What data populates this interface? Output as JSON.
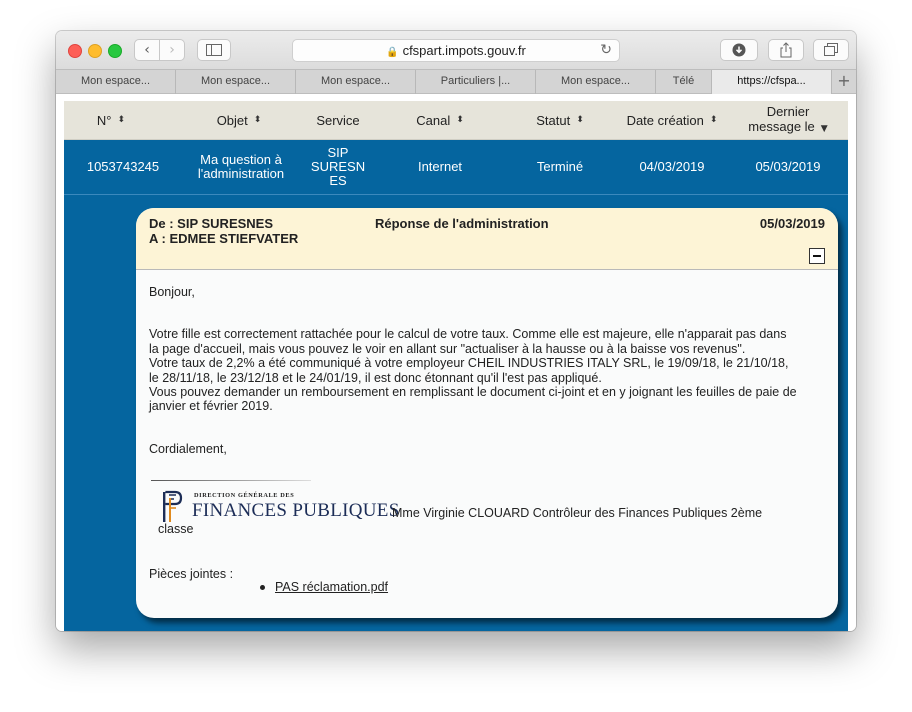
{
  "browser": {
    "url": "cfspart.impots.gouv.fr",
    "tabs": [
      {
        "label": "Mon espace..."
      },
      {
        "label": "Mon espace..."
      },
      {
        "label": "Mon espace..."
      },
      {
        "label": "Particuliers |..."
      },
      {
        "label": "Mon espace..."
      },
      {
        "label": "Télé"
      },
      {
        "label": "https://cfspa..."
      }
    ],
    "icons": {
      "back": "chevron-left-icon",
      "forward": "chevron-right-icon",
      "sidebar": "sidebar-icon",
      "lock": "lock-icon",
      "reload": "reload-icon",
      "download": "download-icon",
      "share": "share-icon",
      "tabs": "tabs-overview-icon",
      "new_tab": "plus-icon"
    }
  },
  "table": {
    "headers": {
      "num": "N°",
      "objet": "Objet",
      "service": "Service",
      "canal": "Canal",
      "statut": "Statut",
      "date_creation": "Date création",
      "dernier_message_1": "Dernier",
      "dernier_message_2": "message le"
    },
    "row": {
      "num": "1053743245",
      "objet_1": "Ma question à",
      "objet_2": "l'administration",
      "service_1": "SIP",
      "service_2": "SURESN",
      "service_3": "ES",
      "canal": "Internet",
      "statut": "Terminé",
      "date_creation": "04/03/2019",
      "dernier_message": "05/03/2019"
    }
  },
  "message": {
    "from": "De : SIP SURESNES",
    "to": "A : EDMEE STIEFVATER",
    "subject": "Réponse de l'administration",
    "date": "05/03/2019",
    "greeting": "Bonjour,",
    "lines": [
      "Votre fille est correctement rattachée pour le calcul de votre taux. Comme elle est majeure, elle n'apparait pas dans",
      "la page d'accueil, mais vous pouvez le voir en allant sur \"actualiser à la hausse ou à la baisse vos revenus\".",
      "Votre taux de 2,2% a été communiqué à votre employeur CHEIL INDUSTRIES ITALY SRL, le 19/09/18, le 21/10/18,",
      "le 28/11/18, le 23/12/18 et le 24/01/19, il est donc étonnant qu'il l'est pas appliqué.",
      "Vous pouvez demander un remboursement en remplissant le document ci-joint et en y joignant les feuilles de paie de",
      "janvier et février 2019."
    ],
    "closing": "Cordialement,",
    "logo_small": "DIRECTION GÉNÉRALE DES",
    "logo_big": "FINANCES PUBLIQUES",
    "signature_name": "Mme Virginie CLOUARD Contrôleur des Finances Publiques 2ème",
    "signature_classe": "classe",
    "attachments_label": "Pièces jointes :",
    "attachment": "PAS réclamation.pdf"
  }
}
